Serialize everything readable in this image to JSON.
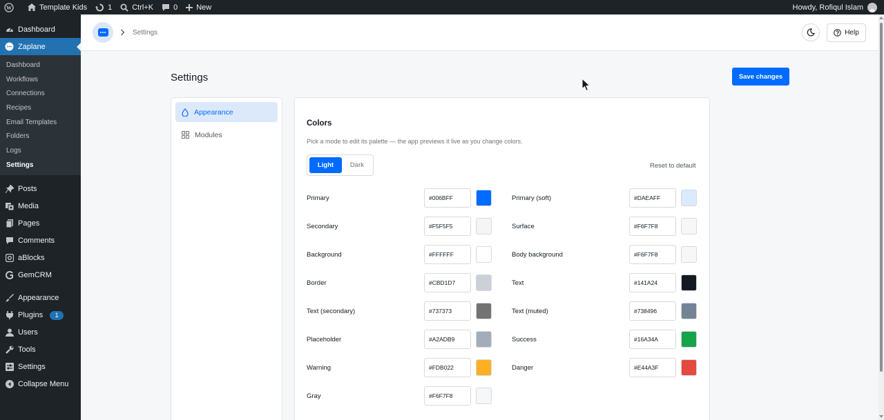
{
  "admin_bar": {
    "site_name": "Template Kids",
    "updates_count": "1",
    "search_shortcut": "Ctrl+K",
    "comments_count": "0",
    "new_label": "New",
    "greeting": "Howdy, Rofiqul Islam"
  },
  "admin_menu": {
    "dashboard": "Dashboard",
    "zaplane": "Zaplane",
    "submenu": [
      "Dashboard",
      "Workflows",
      "Connections",
      "Recipes",
      "Email Templates",
      "Folders",
      "Logs",
      "Settings"
    ],
    "posts": "Posts",
    "media": "Media",
    "pages": "Pages",
    "comments": "Comments",
    "ablocks": "aBlocks",
    "gemcrm": "GemCRM",
    "appearance": "Appearance",
    "plugins": "Plugins",
    "plugins_badge": "1",
    "users": "Users",
    "tools": "Tools",
    "settings": "Settings",
    "collapse": "Collapse Menu"
  },
  "header": {
    "breadcrumb": "Settings",
    "help_label": "Help"
  },
  "page": {
    "title": "Settings",
    "save_label": "Save changes"
  },
  "side_nav": {
    "items": [
      "Appearance",
      "Modules"
    ]
  },
  "colors_panel": {
    "title": "Colors",
    "description": "Pick a mode to edit its palette — the app previews it live as you change colors.",
    "mode_light": "Light",
    "mode_dark": "Dark",
    "reset_label": "Reset to default",
    "left": [
      {
        "label": "Primary",
        "value": "#006BFF",
        "color": "#006bff"
      },
      {
        "label": "Secondary",
        "value": "#F5F5F5",
        "color": "#f5f5f5"
      },
      {
        "label": "Background",
        "value": "#FFFFFF",
        "color": "#ffffff"
      },
      {
        "label": "Border",
        "value": "#CBD1D7",
        "color": "#cbd1d7"
      },
      {
        "label": "Text (secondary)",
        "value": "#737373",
        "color": "#737373"
      },
      {
        "label": "Placeholder",
        "value": "#A2ADB9",
        "color": "#a2adb9"
      },
      {
        "label": "Warning",
        "value": "#FDB022",
        "color": "#fdb022"
      },
      {
        "label": "Gray",
        "value": "#F6F7F8",
        "color": "#f6f7f8"
      }
    ],
    "right": [
      {
        "label": "Primary (soft)",
        "value": "#DAEAFF",
        "color": "#daeaff"
      },
      {
        "label": "Surface",
        "value": "#F6F7F8",
        "color": "#f6f7f8"
      },
      {
        "label": "Body background",
        "value": "#F6F7F8",
        "color": "#f6f7f8"
      },
      {
        "label": "Text",
        "value": "#141A24",
        "color": "#141a24"
      },
      {
        "label": "Text (muted)",
        "value": "#738496",
        "color": "#738496"
      },
      {
        "label": "Success",
        "value": "#16A34A",
        "color": "#16a34a"
      },
      {
        "label": "Danger",
        "value": "#E44A3F",
        "color": "#e44a3f"
      }
    ]
  }
}
